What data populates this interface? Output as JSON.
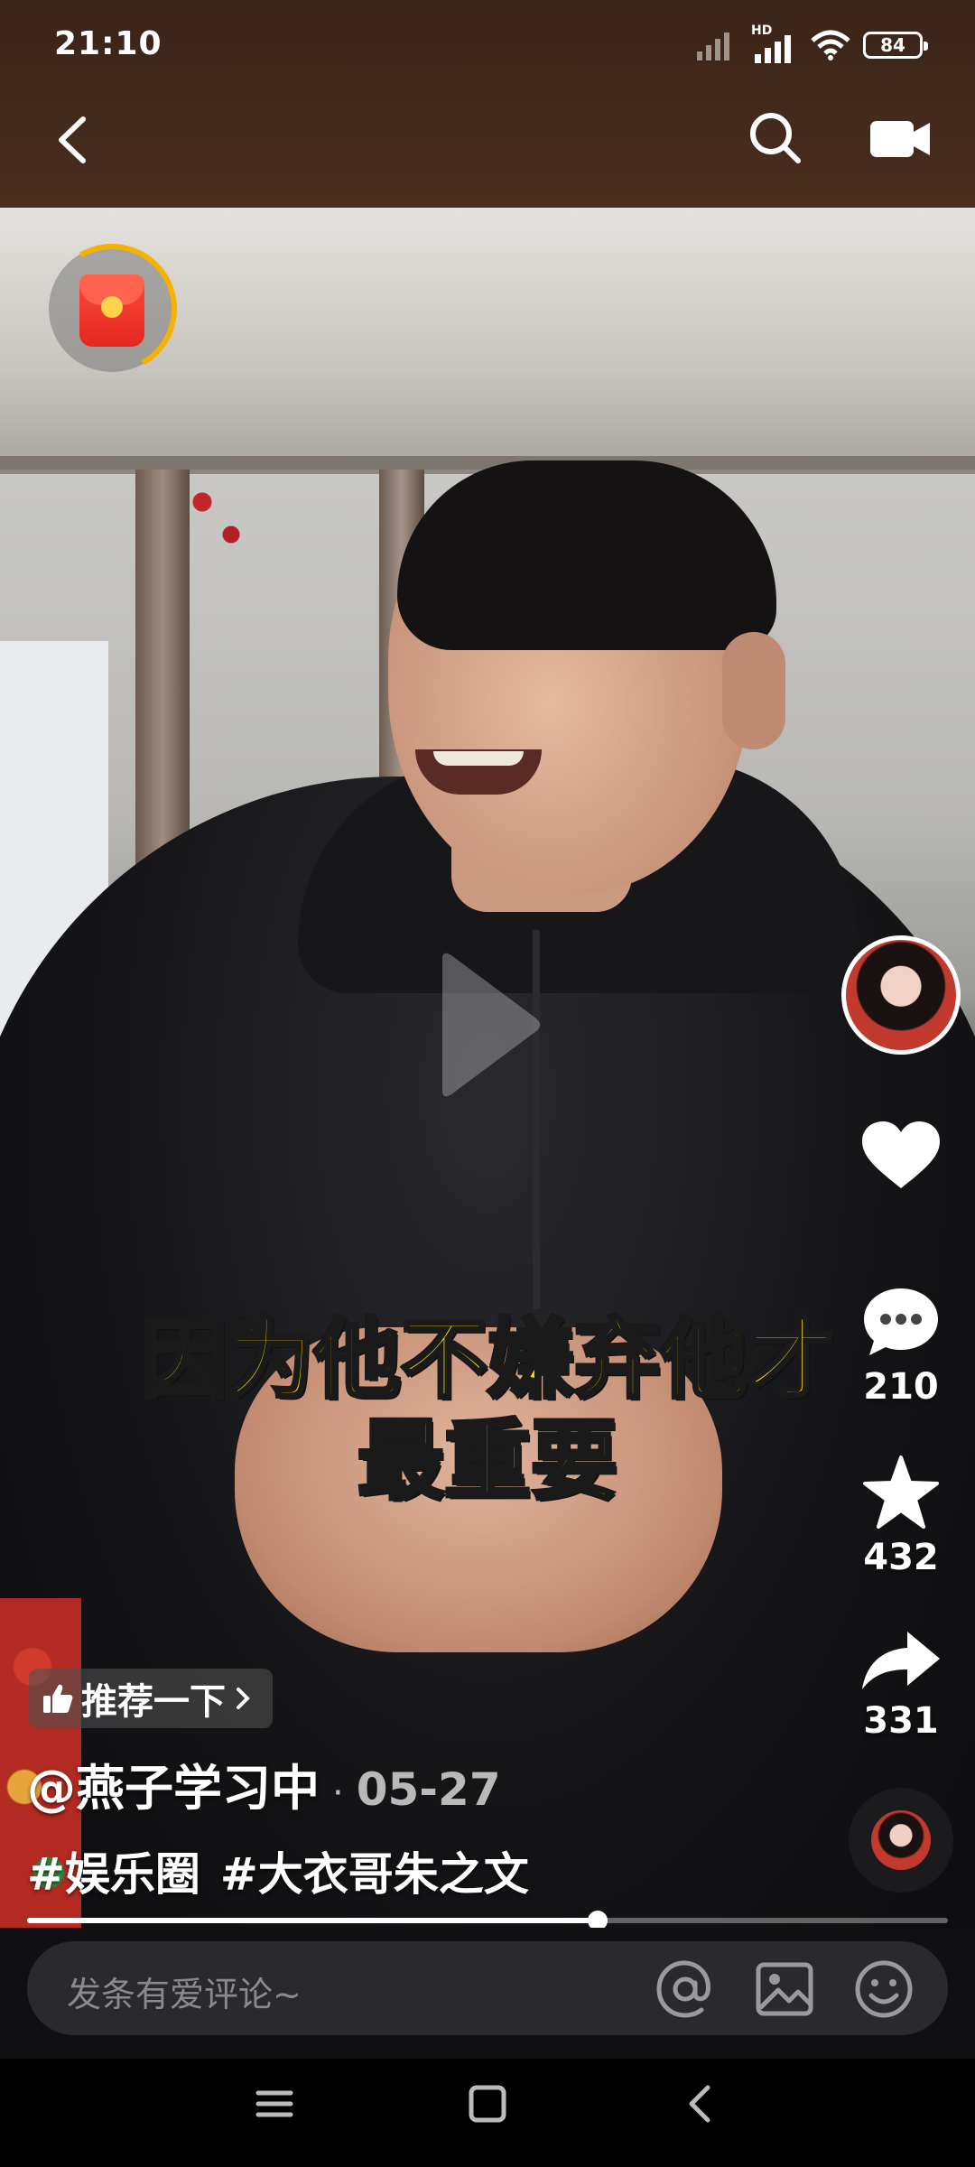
{
  "status_bar": {
    "time": "21:10",
    "network": "HD",
    "battery": "84"
  },
  "video": {
    "subtitle_line1": "因为他不嫌弃他才",
    "subtitle_line2": "最重要",
    "progress_fraction": 0.62
  },
  "actions": {
    "comment_count": "210",
    "favorite_count": "432",
    "share_count": "331"
  },
  "info": {
    "recommend_label": "推荐一下",
    "author": "@燕子学习中",
    "separator": "·",
    "date": "05-27",
    "hashtags": [
      "#娱乐圈",
      "#大衣哥朱之文"
    ]
  },
  "comment_bar": {
    "placeholder": "发条有爱评论~"
  },
  "icons": {
    "back": "chevron-left-icon",
    "search": "search-icon",
    "camera": "video-camera-icon",
    "like": "heart-icon",
    "comment": "chat-bubble-icon",
    "favorite": "star-icon",
    "share": "share-arrow-icon",
    "mention": "at-icon",
    "image": "image-icon",
    "emoji": "emoji-icon"
  },
  "colors": {
    "subtitle": "#ffe100",
    "red_packet_ring": "#f5b300"
  }
}
